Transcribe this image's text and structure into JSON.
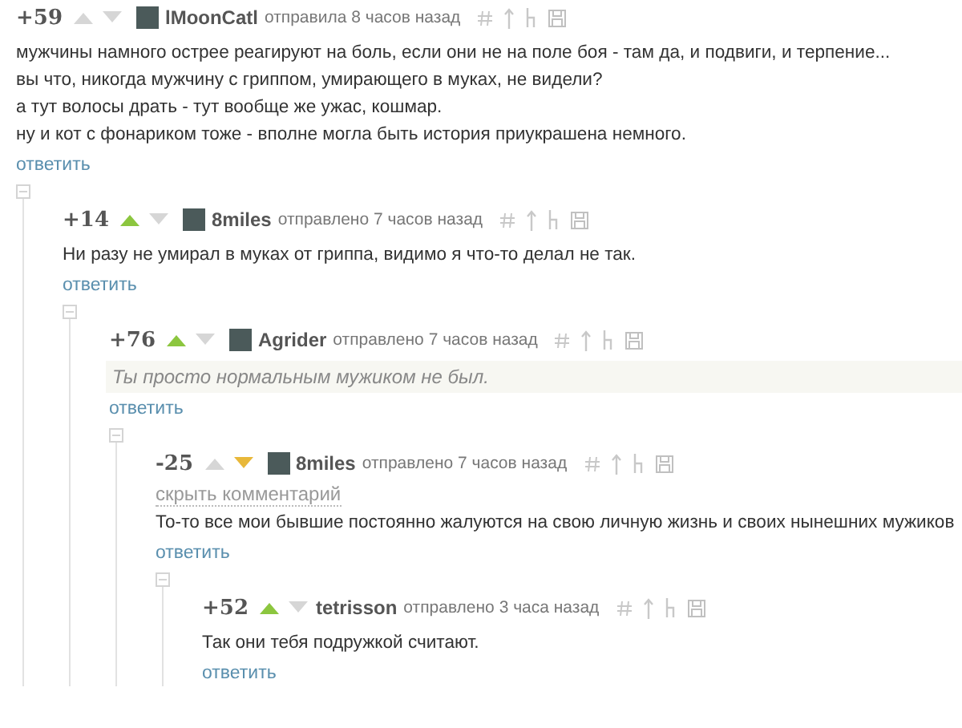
{
  "comments": [
    {
      "rating": "+59",
      "voted_up": false,
      "voted_down": false,
      "avatar": true,
      "username": "lMoonCatl",
      "time": "отправила 8 часов назад",
      "kind": "plain",
      "paragraphs": [
        "мужчины намного острее реагируют на боль, если они не на поле боя - там да, и подвиги, и терпение...",
        "вы что, никогда мужчину с гриппом, умирающего в муках, не видели?",
        "а тут волосы драть - тут вообще же ужас, кошмар.",
        "ну и кот с фонариком тоже - вполне могла быть история приукрашена немного."
      ],
      "reply": "ответить",
      "children": [
        {
          "rating": "+14",
          "voted_up": true,
          "voted_down": false,
          "avatar": true,
          "username": "8miles",
          "time": "отправлено 7 часов назад",
          "kind": "plain",
          "paragraphs": [
            "Ни разу не умирал в муках от гриппа, видимо я что-то делал не так."
          ],
          "reply": "ответить",
          "children": [
            {
              "rating": "+76",
              "voted_up": true,
              "voted_down": false,
              "avatar": true,
              "username": "Agrider",
              "time": "отправлено 7 часов назад",
              "kind": "quote",
              "paragraphs": [
                "Ты просто нормальным мужиком не был."
              ],
              "reply": "ответить",
              "children": [
                {
                  "rating": "-25",
                  "voted_up": false,
                  "voted_down": true,
                  "avatar": true,
                  "username": "8miles",
                  "time": "отправлено 7 часов назад",
                  "kind": "plain",
                  "hide_label": "скрыть комментарий",
                  "paragraphs": [
                    "То-то все мои бывшие постоянно жалуются на свою личную жизнь и своих нынешних мужиков"
                  ],
                  "reply": "ответить",
                  "children": [
                    {
                      "rating": "+52",
                      "voted_up": true,
                      "voted_down": false,
                      "avatar": false,
                      "username": "tetrisson",
                      "time": "отправлено 3 часа назад",
                      "kind": "plain",
                      "paragraphs": [
                        "Так они тебя подружкой считают."
                      ],
                      "reply": "ответить"
                    }
                  ]
                }
              ]
            }
          ]
        }
      ]
    }
  ]
}
